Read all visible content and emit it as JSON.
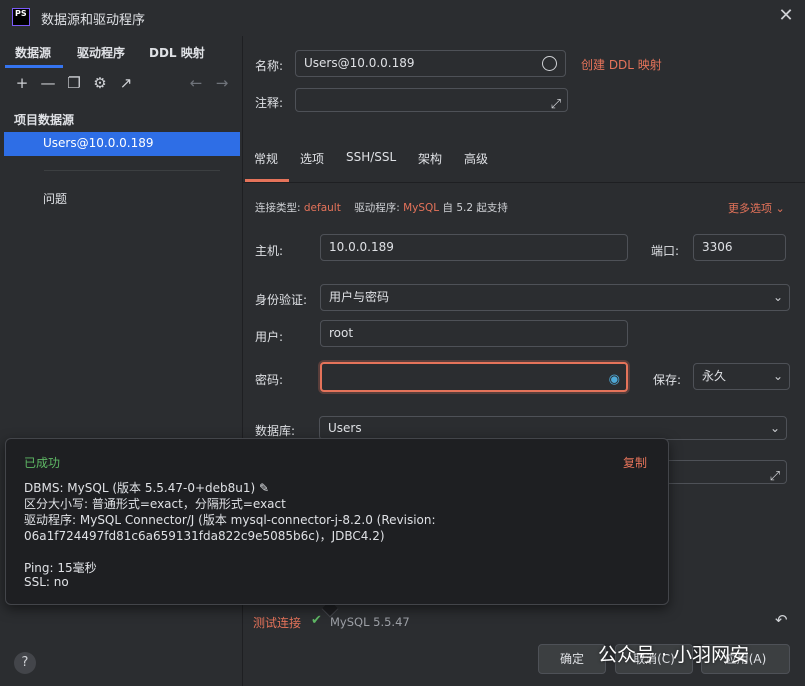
{
  "window": {
    "title": "数据源和驱动程序",
    "app_logo": "PS"
  },
  "left": {
    "tabs": [
      "数据源",
      "驱动程序",
      "DDL 映射"
    ],
    "group_label": "项目数据源",
    "selected_item": "Users@10.0.0.189",
    "problems_label": "问题"
  },
  "form": {
    "name_label": "名称:",
    "name_value": "Users@10.0.0.189",
    "ddl_link": "创建 DDL 映射",
    "comment_label": "注释:",
    "comment_value": "",
    "tabs": [
      "常规",
      "选项",
      "SSH/SSL",
      "架构",
      "高级"
    ],
    "conn_type_label": "连接类型:",
    "conn_type_value": "default",
    "driver_label": "驱动程序:",
    "driver_value": "MySQL",
    "driver_support": "自 5.2 起支持",
    "more_options": "更多选项",
    "host_label": "主机:",
    "host_value": "10.0.0.189",
    "port_label": "端口:",
    "port_value": "3306",
    "auth_label": "身份验证:",
    "auth_value": "用户与密码",
    "user_label": "用户:",
    "user_value": "root",
    "password_label": "密码:",
    "password_value": "",
    "save_label": "保存:",
    "save_value": "永久",
    "db_label": "数据库:",
    "db_value": "Users",
    "url_value": "",
    "test_link": "测试连接",
    "test_status": "MySQL 5.5.47"
  },
  "popup": {
    "status": "已成功",
    "copy": "复制",
    "line1": "DBMS: MySQL (版本 5.5.47-0+deb8u1)",
    "line2": "区分大小写: 普通形式=exact，分隔形式=exact",
    "line3": "驱动程序: MySQL Connector/J (版本 mysql-connector-j-8.2.0 (Revision:",
    "line4": "06a1f724497fd81c6a659131fda822c9e5085b6c)，JDBC4.2)",
    "line5": "Ping: 15毫秒",
    "line6": "SSL: no"
  },
  "buttons": {
    "ok": "确定",
    "cancel": "取消(C)",
    "apply": "应用(A)"
  },
  "watermark": "公众号 · 小羽网安",
  "colors": {
    "accent": "#e5735a",
    "selection": "#2e6ee6",
    "success": "#5fb865"
  }
}
